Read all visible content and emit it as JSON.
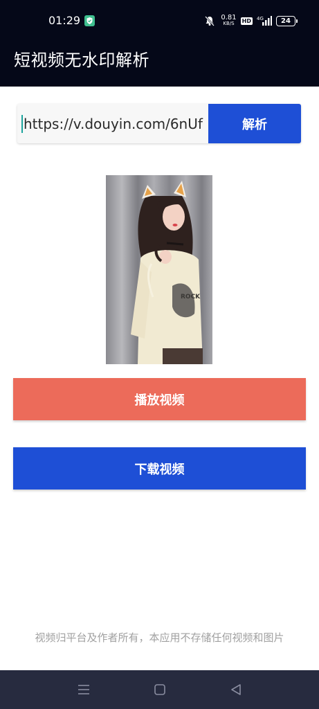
{
  "status_bar": {
    "time": "01:29",
    "net_speed_value": "0.81",
    "net_speed_unit": "KB/S",
    "hd_label": "HD",
    "network_label": "4G",
    "battery_level": "24"
  },
  "app_bar": {
    "title": "短视频无水印解析"
  },
  "parse_form": {
    "url_value": "https://v.douyin.com/6nUf",
    "parse_label": "解析"
  },
  "actions": {
    "play_label": "播放视频",
    "download_label": "下载视频"
  },
  "footer": {
    "disclaimer": "视频归平台及作者所有，本应用不存储任何视频和图片"
  },
  "colors": {
    "header_bg": "#050818",
    "primary_blue": "#1e4fd6",
    "play_red": "#ec6b5a",
    "nav_bar_bg": "#272b3f",
    "disclaimer_gray": "#a0a0a0"
  },
  "icons": {
    "status": [
      "shield-check-icon",
      "mute-bell-icon",
      "signal-icon",
      "battery-icon"
    ],
    "nav": [
      "menu-icon",
      "home-icon",
      "back-icon"
    ]
  }
}
